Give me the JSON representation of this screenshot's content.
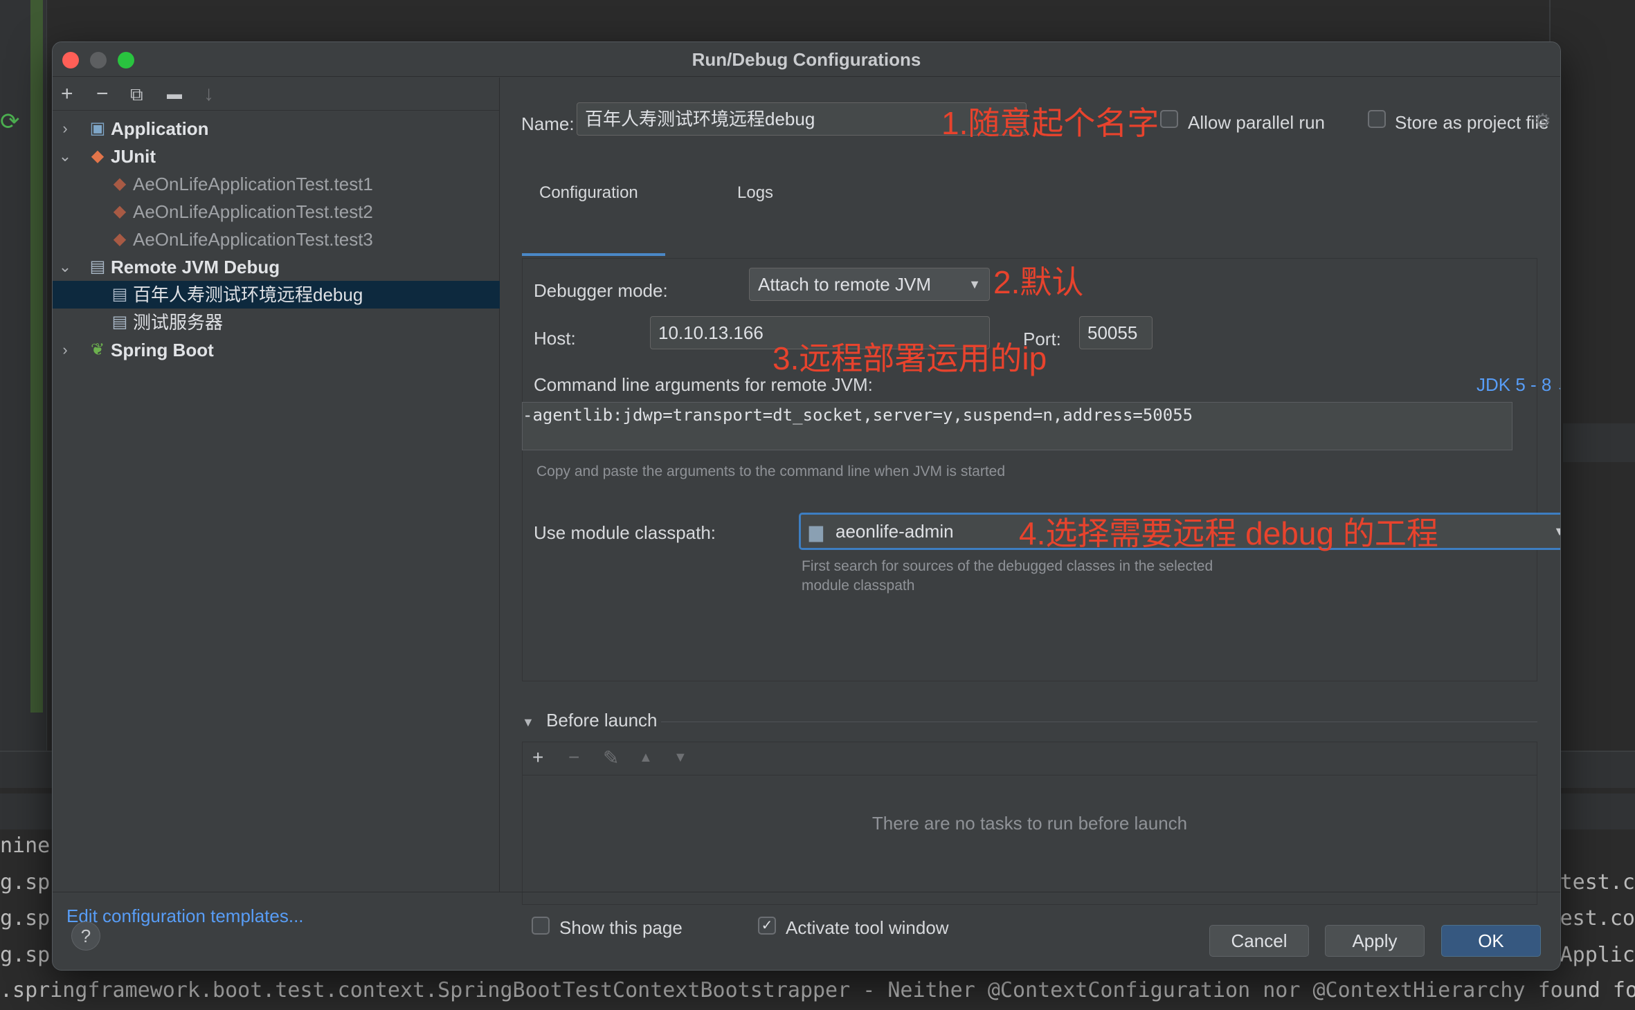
{
  "background": {
    "console_lines_left": [
      "nines",
      "g.spr",
      "g.spr",
      "g.spr"
    ],
    "console_lines_right": [
      "test.c",
      "est.co",
      "Applic"
    ],
    "console_bottom_line": ".springframework.boot.test.context.SpringBootTestContextBootstrapper - Neither @ContextConfiguration nor @ContextHierarchy found for"
  },
  "dialog": {
    "title": "Run/Debug Configurations",
    "toolbar": {
      "add": "+",
      "remove": "−",
      "copy": "⧉",
      "new_folder": "▬",
      "sort": "↓"
    },
    "tree": [
      {
        "label": "Application",
        "bold": true,
        "arrow": "›",
        "icon": "▣",
        "icon_color": "#7fa7c9"
      },
      {
        "label": "JUnit",
        "bold": true,
        "arrow": "⌄",
        "icon": "◆",
        "icon_color": "#e2754a"
      },
      {
        "label": "AeOnLifeApplicationTest.test1",
        "bold": false,
        "arrow": "",
        "icon": "◆",
        "icon_color": "#a85a44"
      },
      {
        "label": "AeOnLifeApplicationTest.test2",
        "bold": false,
        "arrow": "",
        "icon": "◆",
        "icon_color": "#a85a44"
      },
      {
        "label": "AeOnLifeApplicationTest.test3",
        "bold": false,
        "arrow": "",
        "icon": "◆",
        "icon_color": "#a85a44"
      },
      {
        "label": "Remote JVM Debug",
        "bold": true,
        "arrow": "⌄",
        "icon": "▤",
        "icon_color": "#a9b7c6"
      },
      {
        "label": "百年人寿测试环境远程debug",
        "bold": false,
        "arrow": "",
        "icon": "▤",
        "icon_color": "#a9b7c6",
        "selected": true
      },
      {
        "label": "测试服务器",
        "bold": false,
        "arrow": "",
        "icon": "▤",
        "icon_color": "#a9b7c6"
      },
      {
        "label": "Spring Boot",
        "bold": true,
        "arrow": "›",
        "icon": "❦",
        "icon_color": "#6cb04e"
      }
    ],
    "edit_templates": "Edit configuration templates...",
    "help": "?",
    "name_label": "Name:",
    "name_value": "百年人寿测试环境远程debug",
    "allow_parallel": "Allow parallel run",
    "store_as_project": "Store as project file",
    "tabs": [
      "Configuration",
      "Logs"
    ],
    "debugger_mode_label": "Debugger mode:",
    "debugger_mode_value": "Attach to remote JVM",
    "host_label": "Host:",
    "host_value": "10.10.13.166",
    "port_label": "Port:",
    "port_value": "50055",
    "cmd_label": "Command line arguments for remote JVM:",
    "jdk_link": "JDK 5 - 8",
    "cmd_value": "-agentlib:jdwp=transport=dt_socket,server=y,suspend=n,address=50055",
    "cmd_hint": "Copy and paste the arguments to the command line when JVM is started",
    "classpath_label": "Use module classpath:",
    "classpath_value": "aeonlife-admin",
    "classpath_hint_1": "First search for sources of the debugged classes in the selected",
    "classpath_hint_2": "module classpath",
    "before_launch": "Before launch",
    "before_launch_empty": "There are no tasks to run before launch",
    "before_launch_toolbar": {
      "add": "+",
      "remove": "−",
      "edit": "✎",
      "up": "▲",
      "down": "▼"
    },
    "show_this_page": "Show this page",
    "activate_tool_window": "Activate tool window",
    "activate_checked": "✓",
    "buttons": {
      "cancel": "Cancel",
      "apply": "Apply",
      "ok": "OK"
    }
  },
  "annotations": {
    "a1": "1.随意起个名字",
    "a2": "2.默认",
    "a3": "3.远程部署运用的ip",
    "a4": "4.选择需要远程 debug 的工程"
  },
  "colors": {
    "accent_blue": "#4a88c7",
    "link": "#589df6",
    "annotation_red": "#e8432d",
    "selection": "#0d293e"
  }
}
